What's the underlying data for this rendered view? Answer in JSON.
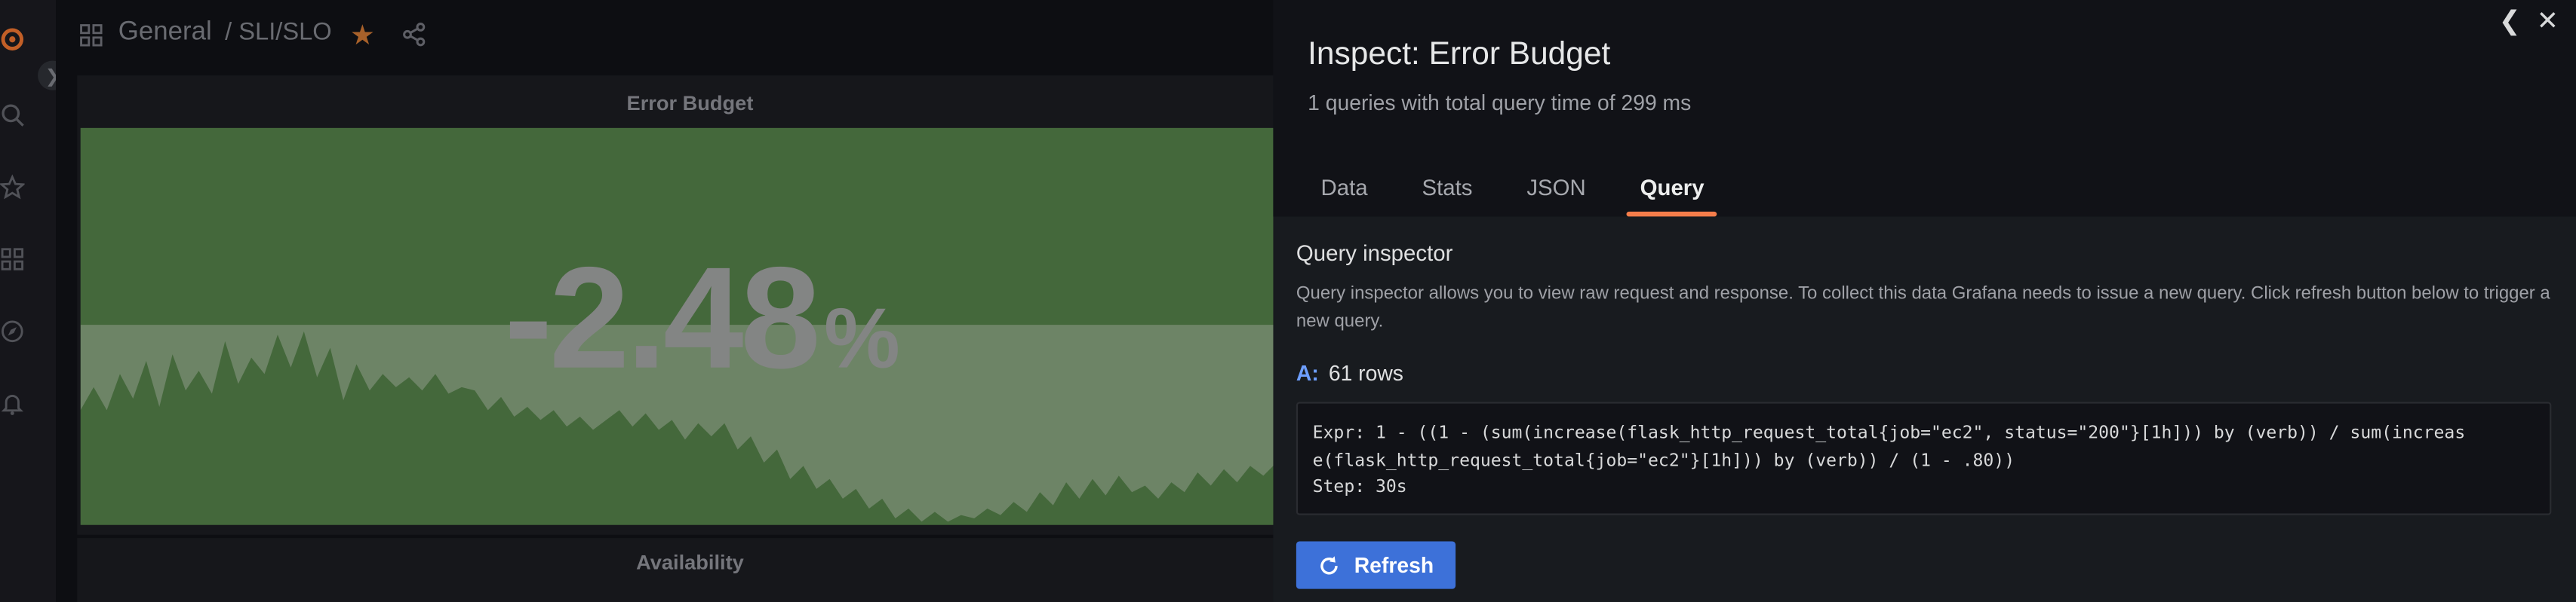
{
  "dashboard": {
    "breadcrumb_folder": "General",
    "breadcrumb_title": "/ SLI/SLO",
    "panel_title": "Error Budget",
    "panel_value": "-2.48",
    "panel_unit": "%",
    "next_panel_title": "Availability"
  },
  "inspect": {
    "title": "Inspect: Error Budget",
    "subtitle": "1 queries with total query time of 299 ms",
    "tabs": [
      {
        "label": "Data"
      },
      {
        "label": "Stats"
      },
      {
        "label": "JSON"
      },
      {
        "label": "Query"
      }
    ],
    "active_tab": "Query",
    "query_inspector_title": "Query inspector",
    "query_inspector_desc": "Query inspector allows you to view raw request and response. To collect this data Grafana needs to issue a new query. Click refresh button below to trigger a new query.",
    "query_ref": "A:",
    "row_count": "61 rows",
    "expr_lines": [
      "Expr: 1 - ((1 - (sum(increase(flask_http_request_total{job=\"ec2\", status=\"200\"}[1h])) by (verb)) / sum(increas",
      "e(flask_http_request_total{job=\"ec2\"}[1h])) by (verb)) / (1 - .80))",
      "Step: 30s"
    ],
    "refresh_label": "Refresh"
  },
  "colors": {
    "accent": "#f57d4a",
    "primary_button": "#3d71d9",
    "panel_green": "#4f7a43",
    "star": "#c9722e"
  }
}
